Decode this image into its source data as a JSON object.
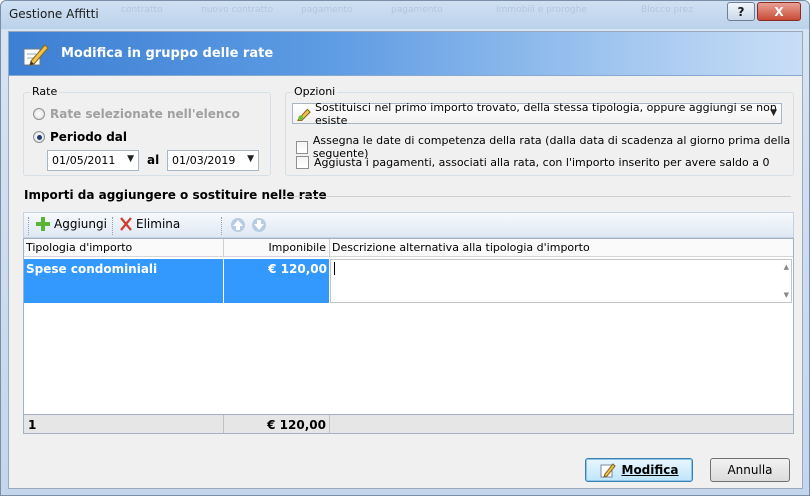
{
  "window": {
    "title": "Gestione Affitti",
    "help_label": "?",
    "close_label": "X",
    "bg_ghost": [
      "contratto",
      "nuovo contratto",
      "pagamento",
      "pagamento",
      "Immobili e proroghe",
      "Blocco prez"
    ]
  },
  "banner": {
    "title": "Modifica in gruppo delle rate"
  },
  "rate_group": {
    "label": "Rate",
    "option_selected_label": "Rate selezionate nell'elenco",
    "option_period_label": "Periodo dal",
    "from_date": "01/05/2011",
    "to_label": "al",
    "to_date": "01/03/2019"
  },
  "options_group": {
    "label": "Opzioni",
    "mode_value": "Sostituisci nel primo importo trovato, della stessa tipologia, oppure aggiungi se non esiste",
    "check1_label": "Assegna le date di competenza della rata (dalla data di scadenza al giorno prima della seguente)",
    "check2_label": "Aggiusta i pagamenti, associati alla rata, con l'importo inserito per avere saldo a 0"
  },
  "section": {
    "title": "Importi da aggiungere o sostituire nelle rate"
  },
  "toolbar": {
    "add_label": "Aggiungi",
    "delete_label": "Elimina"
  },
  "grid": {
    "headers": [
      "Tipologia d'importo",
      "Imponibile",
      "Descrizione alternativa alla tipologia d'importo"
    ],
    "rows": [
      {
        "tipologia": "Spese condominiali",
        "imponibile": "€ 120,00",
        "descrizione": ""
      }
    ],
    "footer_count": "1",
    "footer_total": "€ 120,00"
  },
  "buttons": {
    "modify_label": "Modifica",
    "cancel_label": "Annulla"
  },
  "colors": {
    "selection": "#3399ff",
    "banner": "#3d7fd3"
  }
}
